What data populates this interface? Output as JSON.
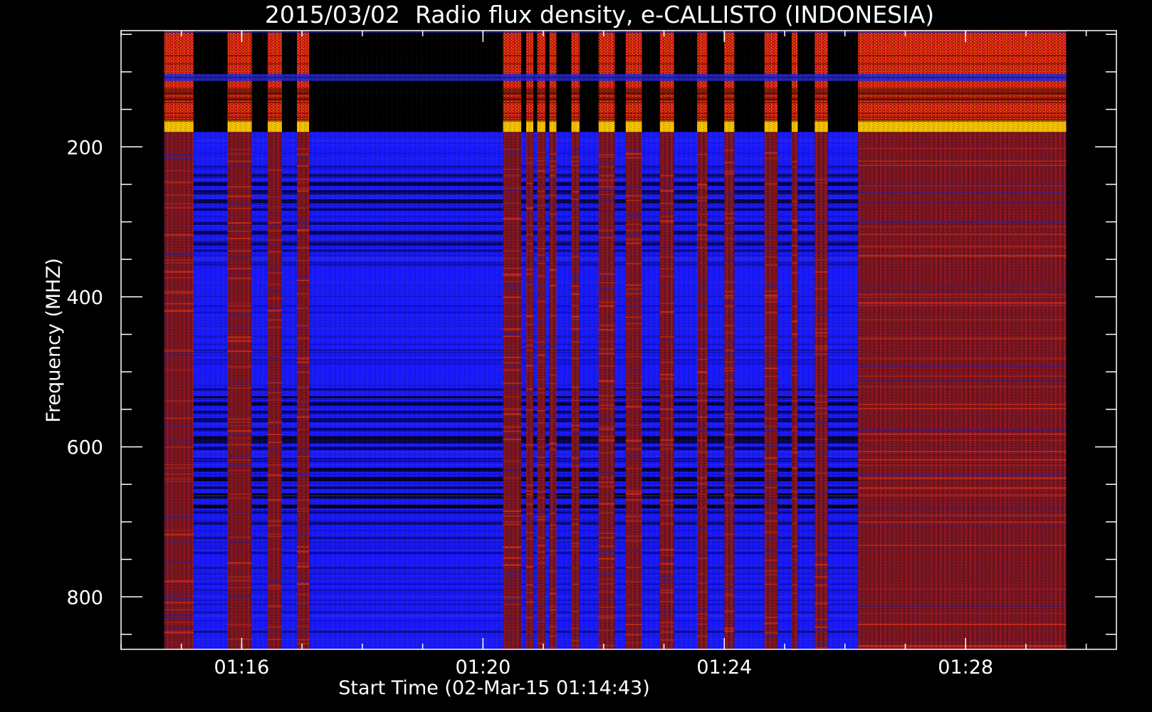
{
  "chart_data": {
    "type": "heatmap",
    "title": "2015/03/02  Radio flux density, e-CALLISTO (INDONESIA)",
    "xlabel": "Start Time (02-Mar-15 01:14:43)",
    "ylabel": "Frequency (MHZ)",
    "x_axis": {
      "unit": "minutes",
      "range": [
        "01:14:00",
        "01:30:30"
      ],
      "major_ticks": [
        "01:16",
        "01:20",
        "01:24",
        "01:28"
      ],
      "minor_tick_step_minutes": 1
    },
    "y_axis": {
      "range": [
        45,
        870
      ],
      "inverted": true,
      "major_ticks": [
        200,
        400,
        600,
        800
      ],
      "minor_tick_step": 50
    },
    "data_extent": {
      "time_start": "01:14:43",
      "time_end": "01:29:40",
      "freq_min": 45,
      "freq_max": 870
    },
    "colormap": {
      "black": "#000000",
      "blue": "#1a1aff",
      "dark_red": "#7a1420",
      "red": "#d81a10",
      "orange": "#ff7a00",
      "yellow": "#ffe000"
    },
    "segments": [
      {
        "t0": "01:14:43",
        "t1": "01:15:12",
        "state": "active"
      },
      {
        "t0": "01:15:12",
        "t1": "01:15:46",
        "state": "quiet"
      },
      {
        "t0": "01:15:46",
        "t1": "01:16:10",
        "state": "active"
      },
      {
        "t0": "01:16:10",
        "t1": "01:16:26",
        "state": "quiet"
      },
      {
        "t0": "01:16:26",
        "t1": "01:16:40",
        "state": "active"
      },
      {
        "t0": "01:16:40",
        "t1": "01:16:55",
        "state": "quiet"
      },
      {
        "t0": "01:16:55",
        "t1": "01:17:07",
        "state": "active"
      },
      {
        "t0": "01:17:07",
        "t1": "01:20:20",
        "state": "quiet"
      },
      {
        "t0": "01:20:20",
        "t1": "01:20:38",
        "state": "active"
      },
      {
        "t0": "01:20:38",
        "t1": "01:20:43",
        "state": "quiet"
      },
      {
        "t0": "01:20:43",
        "t1": "01:20:50",
        "state": "active"
      },
      {
        "t0": "01:20:50",
        "t1": "01:20:54",
        "state": "quiet"
      },
      {
        "t0": "01:20:54",
        "t1": "01:21:02",
        "state": "active"
      },
      {
        "t0": "01:21:02",
        "t1": "01:21:06",
        "state": "quiet"
      },
      {
        "t0": "01:21:06",
        "t1": "01:21:13",
        "state": "active"
      },
      {
        "t0": "01:21:13",
        "t1": "01:21:28",
        "state": "quiet"
      },
      {
        "t0": "01:21:28",
        "t1": "01:21:36",
        "state": "active"
      },
      {
        "t0": "01:21:36",
        "t1": "01:21:55",
        "state": "quiet"
      },
      {
        "t0": "01:21:55",
        "t1": "01:22:11",
        "state": "active"
      },
      {
        "t0": "01:22:11",
        "t1": "01:22:22",
        "state": "quiet"
      },
      {
        "t0": "01:22:22",
        "t1": "01:22:38",
        "state": "active"
      },
      {
        "t0": "01:22:38",
        "t1": "01:22:56",
        "state": "quiet"
      },
      {
        "t0": "01:22:56",
        "t1": "01:23:10",
        "state": "active"
      },
      {
        "t0": "01:23:10",
        "t1": "01:23:33",
        "state": "quiet"
      },
      {
        "t0": "01:23:33",
        "t1": "01:23:43",
        "state": "active"
      },
      {
        "t0": "01:23:43",
        "t1": "01:24:00",
        "state": "quiet"
      },
      {
        "t0": "01:24:00",
        "t1": "01:24:10",
        "state": "active"
      },
      {
        "t0": "01:24:10",
        "t1": "01:24:40",
        "state": "quiet"
      },
      {
        "t0": "01:24:40",
        "t1": "01:24:53",
        "state": "active"
      },
      {
        "t0": "01:24:53",
        "t1": "01:25:07",
        "state": "quiet"
      },
      {
        "t0": "01:25:07",
        "t1": "01:25:13",
        "state": "active"
      },
      {
        "t0": "01:25:13",
        "t1": "01:25:30",
        "state": "quiet"
      },
      {
        "t0": "01:25:30",
        "t1": "01:25:43",
        "state": "active"
      },
      {
        "t0": "01:25:43",
        "t1": "01:26:13",
        "state": "quiet"
      },
      {
        "t0": "01:26:13",
        "t1": "01:29:40",
        "state": "active"
      }
    ]
  }
}
